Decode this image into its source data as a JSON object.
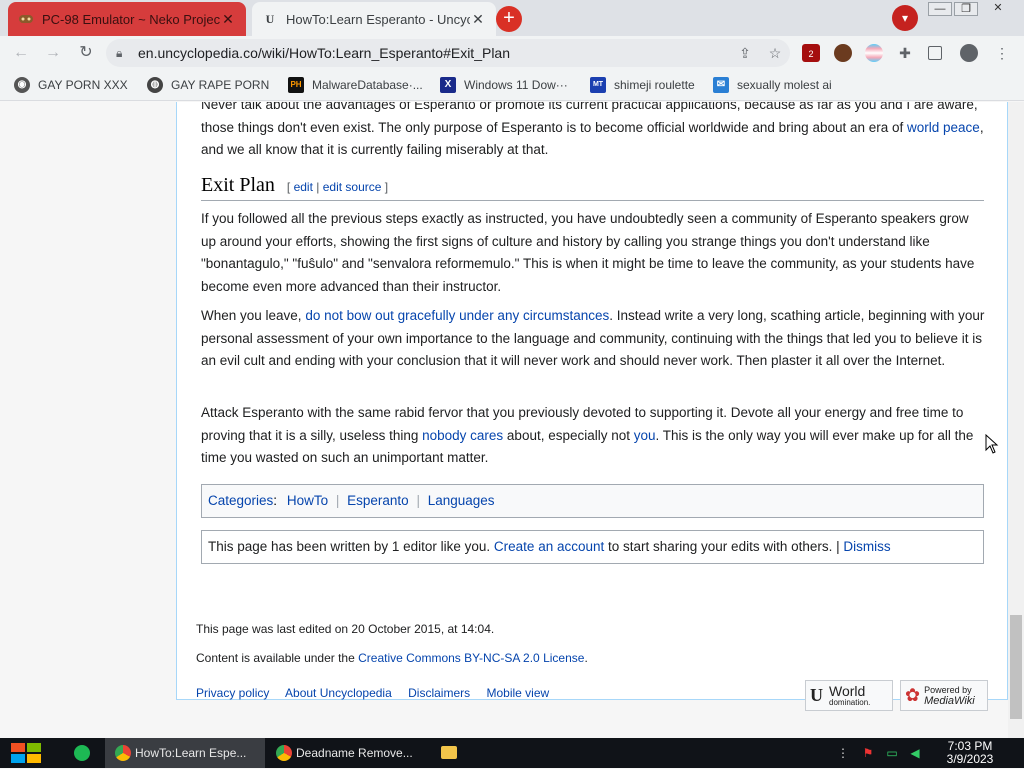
{
  "browser": {
    "tabs": [
      {
        "title": "PC-98 Emulator ~ Neko Project",
        "favicon": "game-controller-icon"
      },
      {
        "title": "HowTo:Learn Esperanto - Uncyclopedia",
        "favicon": "uncyclopedia-icon"
      }
    ],
    "new_tab_symbol": "+",
    "url": "en.uncyclopedia.co/wiki/HowTo:Learn_Esperanto#Exit_Plan",
    "extension_badge": "2",
    "bookmarks": [
      {
        "label": "GAY PORN XXX"
      },
      {
        "label": "GAY RAPE PORN"
      },
      {
        "label": "MalwareDatabase·..."
      },
      {
        "label": "Windows 11 Dow···"
      },
      {
        "label": "shimeji roulette"
      },
      {
        "label": "sexually molest ai"
      }
    ],
    "colors": {
      "active_tab": "#f1f3f4",
      "pinned_red_tab": "#d63c3c",
      "new_tab_button": "#d93025"
    }
  },
  "article": {
    "intro": {
      "before_link": "Never talk about the advantages of Esperanto or promote its current practical applications, because as far as you and I are aware, those things don't even exist. The only purpose of Esperanto is to become official worldwide and bring about an era of ",
      "link": "world peace",
      "after_link": ", and we all know that it is currently failing miserably at that."
    },
    "section_heading": "Exit Plan",
    "edit_open": "[",
    "edit_link": "edit",
    "edit_sep": "|",
    "edit_source_link": "edit source",
    "edit_close": "]",
    "p1": "If you followed all the previous steps exactly as instructed, you have undoubtedly seen a community of Esperanto speakers grow up around your efforts, showing the first signs of culture and history by calling you strange things you don't understand like \"bonantagulo,\" \"fuŝulo\" and \"senvalora reformemulo.\" This is when it might be time to leave the community, as your students have become even more advanced than their instructor.",
    "p2": {
      "before_link": "When you leave, ",
      "link": "do not bow out gracefully under any circumstances",
      "after_link": ". Instead write a very long, scathing article, beginning with your personal assessment of your own importance to the language and community, continuing with the things that led you to believe it is an evil cult and ending with your conclusion that it will never work and should never work. Then plaster it all over the Internet."
    },
    "p3": {
      "part1": "Attack Esperanto with the same rabid fervor that you previously devoted to supporting it. Devote all your energy and free time to proving that it is a silly, useless thing ",
      "link1": "nobody cares",
      "part2": " about, especially not ",
      "link2": "you",
      "part3": ". This is the only way you will ever make up for all the time you wasted on such an unimportant matter."
    },
    "categories": {
      "label": "Categories",
      "colon": ":",
      "items": [
        "HowTo",
        "Esperanto",
        "Languages"
      ]
    },
    "editors_notice": {
      "before_link": "This page has been written by 1 editor like you. ",
      "link": "Create an account",
      "after_link": " to start sharing your edits with others. | ",
      "dismiss": "Dismiss"
    }
  },
  "footer": {
    "last_edited": "This page was last edited on 20 October 2015, at 14:04.",
    "license_before": "Content is available under the ",
    "license_link": "Creative Commons BY-NC-SA 2.0 License",
    "license_after": ".",
    "links": [
      "Privacy policy",
      "About Uncyclopedia",
      "Disclaimers",
      "Mobile view"
    ],
    "badge_world": "World",
    "badge_world_sub": "domination.",
    "badge_mediawiki_top": "Powered by",
    "badge_mediawiki": "MediaWiki"
  },
  "taskbar": {
    "tasks": [
      {
        "label": "HowTo:Learn Espe..."
      },
      {
        "label": "Deadname Remove..."
      }
    ],
    "time": "7:03 PM",
    "date": "3/9/2023"
  }
}
